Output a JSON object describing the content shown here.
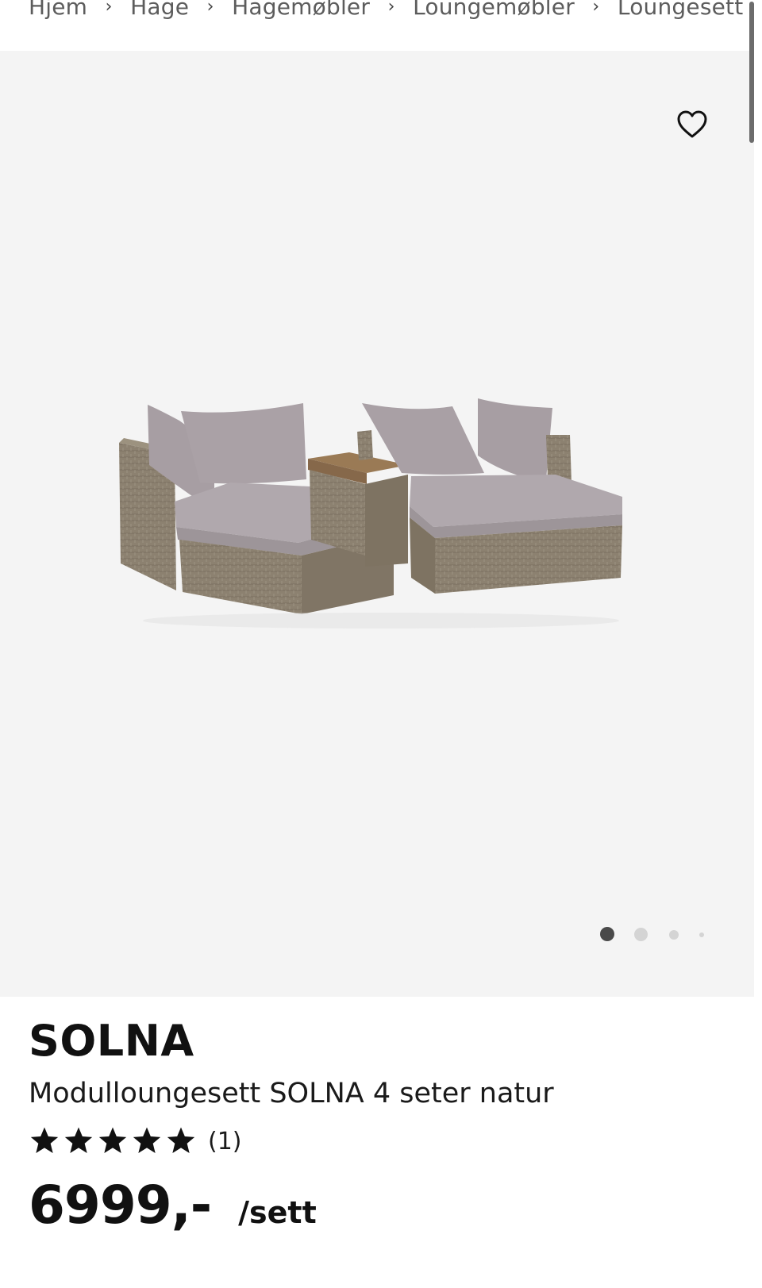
{
  "breadcrumb": {
    "items": [
      "Hjem",
      "Hage",
      "Hagemøbler",
      "Loungemøbler",
      "Loungesett"
    ],
    "separator": "›"
  },
  "gallery": {
    "favorite_icon": "heart-outline-icon",
    "image_alt": "Modulloungesett SOLNA 4 seter natur",
    "active_index": 0,
    "dot_count": 4
  },
  "product": {
    "brand": "SOLNA",
    "name": "Modulloungesett SOLNA 4 seter natur",
    "rating": 5,
    "review_count": "(1)",
    "price": "6999,-",
    "unit": "/sett"
  },
  "colors": {
    "gallery_bg": "#f4f4f4",
    "text": "#111111",
    "cushion": "#a79ea3",
    "wicker": "#8c8170",
    "wood": "#9a7a55"
  }
}
